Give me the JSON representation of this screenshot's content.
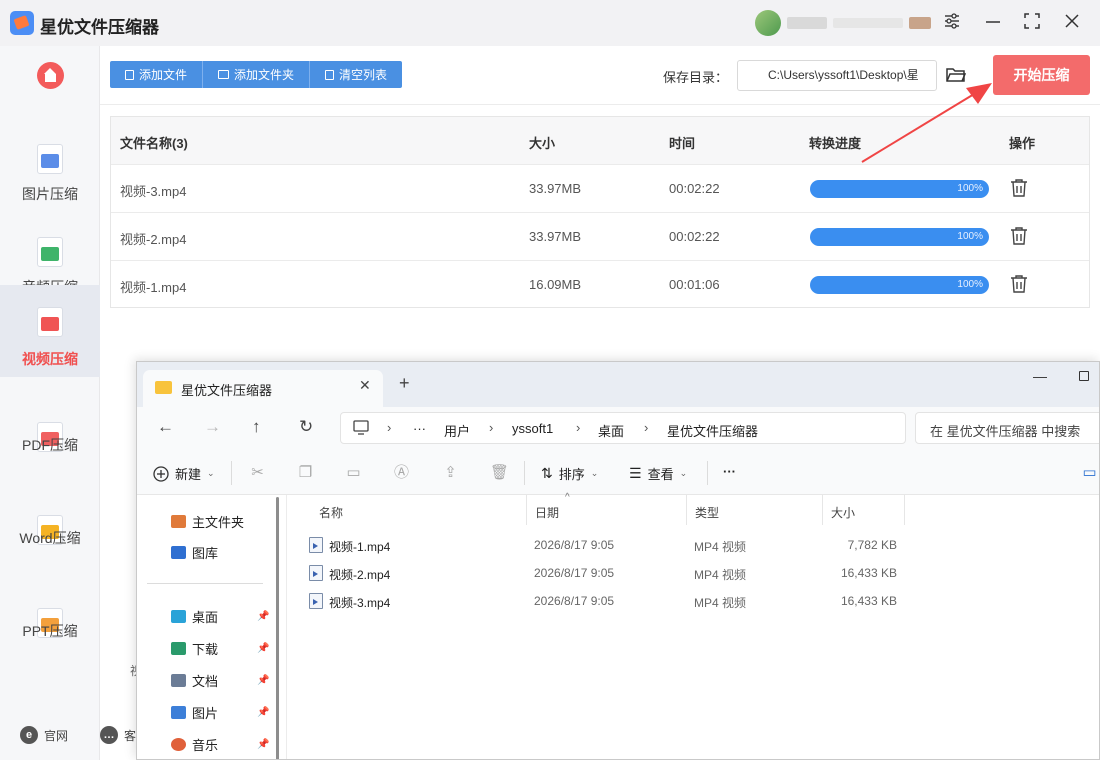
{
  "app": {
    "title": "星优文件压缩器",
    "window_controls": [
      "settings",
      "minimize",
      "maximize",
      "close"
    ]
  },
  "sidebar": {
    "items": [
      {
        "label": "图片压缩",
        "icon": "image-file-icon",
        "color": "#5b8de8",
        "active": false
      },
      {
        "label": "音频压缩",
        "icon": "audio-file-icon",
        "color": "#3fb46a",
        "active": false
      },
      {
        "label": "视频压缩",
        "icon": "video-file-icon",
        "color": "#f05454",
        "active": true
      },
      {
        "label": "PDF压缩",
        "icon": "pdf-file-icon",
        "color": "#f06060",
        "active": false
      },
      {
        "label": "Word压缩",
        "icon": "word-file-icon",
        "color": "#f5b324",
        "active": false
      },
      {
        "label": "PPT压缩",
        "icon": "ppt-file-icon",
        "color": "#f3a03c",
        "active": false
      }
    ],
    "footer": {
      "website": "官网",
      "service": "客"
    },
    "ghost_text": "视"
  },
  "toolbar": {
    "add_file": "添加文件",
    "add_folder": "添加文件夹",
    "clear_list": "清空列表",
    "save_dir_label": "保存目录：",
    "save_dir_value": "C:\\Users\\yssoft1\\Desktop\\星",
    "start_button": "开始压缩"
  },
  "file_table": {
    "headers": [
      "文件名称(3)",
      "大小",
      "时间",
      "转换进度",
      "操作"
    ],
    "rows": [
      {
        "name": "视频-3.mp4",
        "size": "33.97MB",
        "time": "00:02:22",
        "progress": "100%",
        "progress_fraction": 1.0
      },
      {
        "name": "视频-2.mp4",
        "size": "33.97MB",
        "time": "00:02:22",
        "progress": "100%",
        "progress_fraction": 1.0
      },
      {
        "name": "视频-1.mp4",
        "size": "16.09MB",
        "time": "00:01:06",
        "progress": "100%",
        "progress_fraction": 1.0
      }
    ]
  },
  "explorer": {
    "tab_title": "星优文件压缩器",
    "tab_close": "✕",
    "tab_new": "+",
    "breadcrumb": [
      "用户",
      "yssoft1",
      "桌面",
      "星优文件压缩器"
    ],
    "ellipsis": "···",
    "search_placeholder": "在 星优文件压缩器 中搜索",
    "commands": {
      "new": "新建",
      "sort": "排序",
      "view": "查看",
      "more": "···"
    },
    "left_nav": {
      "top": [
        {
          "label": "主文件夹",
          "color": "#e07a3a"
        },
        {
          "label": "图库",
          "color": "#2f6fd1"
        }
      ],
      "quick": [
        {
          "label": "桌面",
          "color": "#2aa3d8"
        },
        {
          "label": "下载",
          "color": "#2a9a6b"
        },
        {
          "label": "文档",
          "color": "#6b7c96"
        },
        {
          "label": "图片",
          "color": "#3d7fd8"
        },
        {
          "label": "音乐",
          "color": "#e0603a"
        }
      ]
    },
    "columns": [
      "名称",
      "日期",
      "类型",
      "大小"
    ],
    "files": [
      {
        "name": "视频-1.mp4",
        "date": "2026/8/17 9:05",
        "type": "MP4 视频",
        "size": "7,782 KB"
      },
      {
        "name": "视频-2.mp4",
        "date": "2026/8/17 9:05",
        "type": "MP4 视频",
        "size": "16,433 KB"
      },
      {
        "name": "视频-3.mp4",
        "date": "2026/8/17 9:05",
        "type": "MP4 视频",
        "size": "16,433 KB"
      }
    ]
  },
  "colors": {
    "accent_blue": "#4a90e2",
    "start_red": "#f36b6b",
    "progress_blue": "#3a8ef0",
    "active_nav_red": "#f0504f"
  }
}
